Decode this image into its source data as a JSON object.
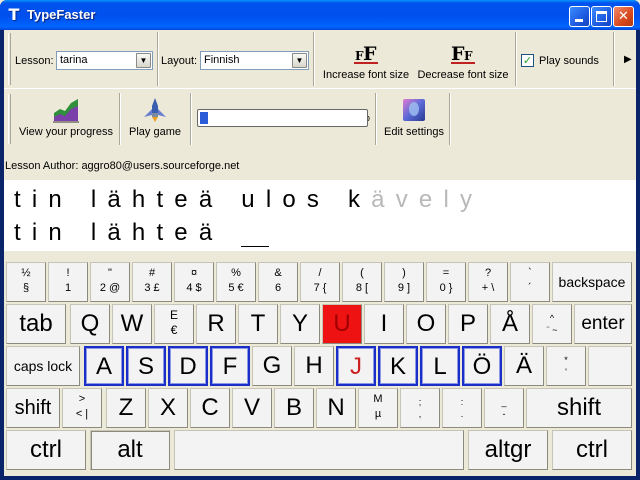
{
  "window": {
    "title": "TypeFaster",
    "app_icon_letter": "T"
  },
  "toolbar": {
    "lesson_label": "Lesson:",
    "lesson_value": "tarina",
    "layout_label": "Layout:",
    "layout_value": "Finnish",
    "increase_font": "Increase font size",
    "decrease_font": "Decrease font size",
    "play_sounds": "Play sounds",
    "play_sounds_checked": true,
    "view_progress": "View your progress",
    "play_game": "Play game",
    "progress_percent_text": "5%",
    "progress_value": 0.05,
    "edit_settings": "Edit settings"
  },
  "author_line": "Lesson Author: aggro80@users.sourceforge.net",
  "lesson": {
    "line1_typed": "tin lähteä ulos k",
    "line1_remaining": "ävely",
    "line2_typed": "tin lähteä "
  },
  "keyboard": {
    "row1": [
      {
        "top": "½",
        "bot": "§"
      },
      {
        "top": "!",
        "bot": "1"
      },
      {
        "top": "\"",
        "bot": "2 @"
      },
      {
        "top": "#",
        "bot": "3 £"
      },
      {
        "top": "¤",
        "bot": "4 $"
      },
      {
        "top": "%",
        "bot": "5 €"
      },
      {
        "top": "&",
        "bot": "6"
      },
      {
        "top": "/",
        "bot": "7 {"
      },
      {
        "top": "(",
        "bot": "8 ["
      },
      {
        "top": ")",
        "bot": "9 ]"
      },
      {
        "top": "=",
        "bot": "0 }"
      },
      {
        "top": "?",
        "bot": "+ \\"
      },
      {
        "top": "`",
        "bot": "´"
      }
    ],
    "backspace": "backspace",
    "tab": "tab",
    "row2": [
      "Q",
      "W",
      "E",
      "R",
      "T",
      "Y",
      "U",
      "I",
      "O",
      "P",
      "Å"
    ],
    "e_alt": "€",
    "row2_last_top": "^",
    "row2_last_bot": "¨ ~",
    "enter": "enter",
    "active_key": "U",
    "caps_lock": "caps lock",
    "row3": [
      "A",
      "S",
      "D",
      "F",
      "G",
      "H",
      "J",
      "K",
      "L",
      "Ö",
      "Ä"
    ],
    "row3_last_top": "*",
    "row3_last_bot": "'",
    "shift": "shift",
    "lt_top": ">",
    "lt_bot": "< |",
    "row4": [
      "Z",
      "X",
      "C",
      "V",
      "B",
      "N"
    ],
    "m_top": "M",
    "m_bot": "µ",
    "comma_top": ";",
    "comma_bot": ",",
    "period_top": ":",
    "period_bot": ".",
    "dash_top": "_",
    "dash_bot": "-",
    "ctrl": "ctrl",
    "alt": "alt",
    "altgr": "altgr"
  },
  "colors": {
    "home_key_border": "#1a2fc8",
    "active_key": "#ee1212",
    "titlebar": "#0053ee"
  }
}
